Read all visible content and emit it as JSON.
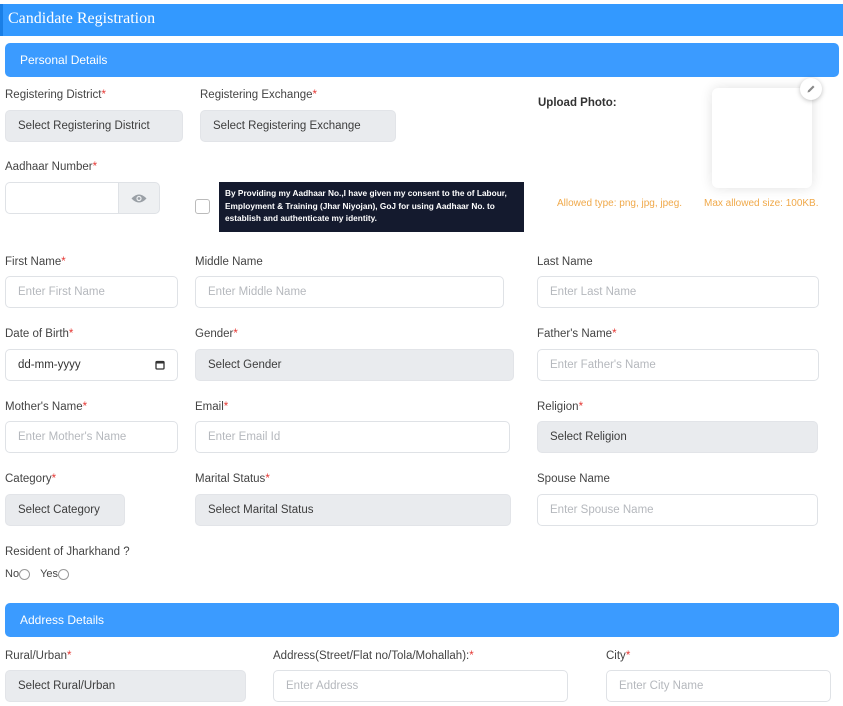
{
  "page_title": "Candidate Registration",
  "sections": {
    "personal": "Personal Details",
    "address": "Address Details"
  },
  "required_marker": "*",
  "fields": {
    "registering_district": {
      "label": "Registering District",
      "value": "Select Registering District"
    },
    "registering_exchange": {
      "label": "Registering Exchange",
      "value": "Select Registering Exchange"
    },
    "aadhaar": {
      "label": "Aadhaar Number",
      "value": ""
    },
    "first_name": {
      "label": "First Name",
      "placeholder": "Enter First Name"
    },
    "middle_name": {
      "label": "Middle Name",
      "placeholder": "Enter Middle Name"
    },
    "last_name": {
      "label": "Last Name",
      "placeholder": "Enter Last Name"
    },
    "dob": {
      "label": "Date of Birth",
      "placeholder": "dd-mm-yyyy"
    },
    "gender": {
      "label": "Gender",
      "value": "Select Gender"
    },
    "father_name": {
      "label": "Father's Name",
      "placeholder": "Enter Father's Name"
    },
    "mother_name": {
      "label": "Mother's Name",
      "placeholder": "Enter Mother's Name"
    },
    "email": {
      "label": "Email",
      "placeholder": "Enter Email Id"
    },
    "religion": {
      "label": "Religion",
      "value": "Select Religion"
    },
    "category": {
      "label": "Category",
      "value": "Select Category"
    },
    "marital_status": {
      "label": "Marital Status",
      "value": "Select Marital Status"
    },
    "spouse_name": {
      "label": "Spouse Name",
      "placeholder": "Enter Spouse Name"
    },
    "resident": {
      "label": "Resident of Jharkhand ?",
      "options": [
        "No",
        "Yes"
      ]
    },
    "rural_urban": {
      "label": "Rural/Urban",
      "value": "Select Rural/Urban"
    },
    "address": {
      "label": "Address(Street/Flat no/Tola/Mohallah):",
      "placeholder": "Enter Address"
    },
    "city": {
      "label": "City",
      "placeholder": "Enter City Name"
    }
  },
  "consent_text": "By Providing my Aadhaar No.,I have given my consent to the of Labour, Employment & Training (Jhar Niyojan), GoJ for using Aadhaar No. to establish and authenticate my identity.",
  "upload": {
    "label": "Upload Photo:",
    "allowed_type": "Allowed type: png, jpg, jpeg.",
    "max_size": "Max allowed size: 100KB."
  },
  "colors": {
    "primary": "#3b9bff",
    "required": "#e53935",
    "hint": "#f0a94a",
    "consent_bg": "#141a2e"
  }
}
